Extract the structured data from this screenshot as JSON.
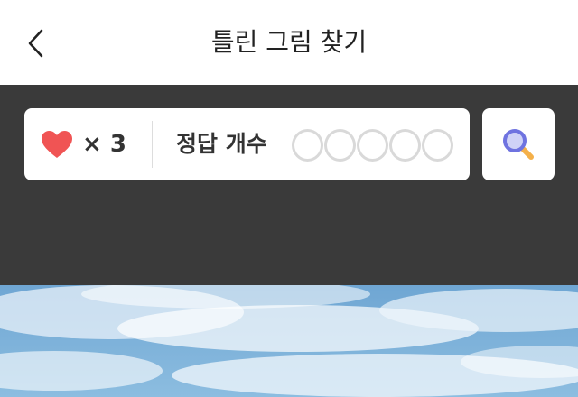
{
  "header": {
    "title": "틀린 그림 찾기",
    "back_icon": "chevron-left-icon"
  },
  "status": {
    "lives_icon": "heart-icon",
    "lives_text": "× 3",
    "answers_label": "정답 개수",
    "answers_total": 5,
    "answers_found": 0
  },
  "hint": {
    "icon": "search-icon"
  },
  "colors": {
    "heart": "#f05454",
    "dark_bg": "#3a3a3a",
    "slot_border": "#d9d9d9",
    "search_handle": "#f4b04a",
    "search_lens": "#6f73e0",
    "sky": "#7fb1d8"
  }
}
